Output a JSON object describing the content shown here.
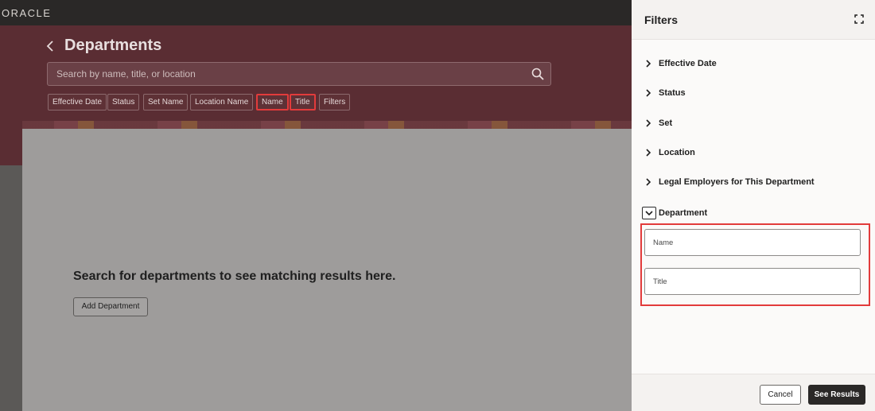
{
  "app": {
    "logo_text": "ORACLE"
  },
  "header": {
    "title": "Departments",
    "search_placeholder": "Search by name, title, or location",
    "chips": [
      {
        "label": "Effective Date",
        "highlighted": false
      },
      {
        "label": "Status",
        "highlighted": false
      },
      {
        "label": "Set Name",
        "highlighted": false
      },
      {
        "label": "Location Name",
        "highlighted": false
      },
      {
        "label": "Name",
        "highlighted": true
      },
      {
        "label": "Title",
        "highlighted": true
      },
      {
        "label": "Filters",
        "highlighted": false
      }
    ]
  },
  "main": {
    "empty_message": "Search for departments to see matching results here.",
    "add_button_label": "Add Department"
  },
  "filters_panel": {
    "title": "Filters",
    "sections": [
      {
        "label": "Effective Date",
        "expanded": false
      },
      {
        "label": "Status",
        "expanded": false
      },
      {
        "label": "Set",
        "expanded": false
      },
      {
        "label": "Location",
        "expanded": false
      },
      {
        "label": "Legal Employers for This Department",
        "expanded": false
      },
      {
        "label": "Department",
        "expanded": true
      }
    ],
    "department_fields": [
      {
        "placeholder": "Name",
        "value": ""
      },
      {
        "placeholder": "Title",
        "value": ""
      }
    ],
    "cancel_label": "Cancel",
    "see_results_label": "See Results"
  },
  "colors": {
    "accent_highlight": "#e23b3b",
    "header_band": "#5a2d33",
    "primary_button": "#2a2827"
  }
}
